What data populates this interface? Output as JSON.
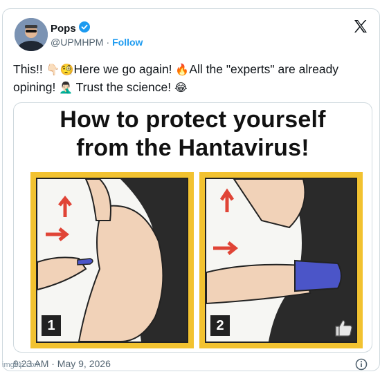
{
  "author": {
    "name": "Pops",
    "handle": "@UPMHPM",
    "follow_label": "Follow",
    "verified": true
  },
  "post": {
    "segment1": "This!! ",
    "emoji1": "👇🏻",
    "emoji2": "🧐",
    "segment2": "Here we go again! ",
    "emoji3": "🔥",
    "segment3": "All the \"experts\" are already opining! ",
    "emoji4": "🤦🏻‍♂️",
    "segment4": " Trust the science! ",
    "emoji5": "😂"
  },
  "media": {
    "title_line1": "How to protect yourself",
    "title_line2": "from the Hantavirus!",
    "panel1_number": "1",
    "panel2_number": "2"
  },
  "timestamp": "9:23 AM · May 9, 2026",
  "watermark": "imgflip.com",
  "icons": [
    "x-logo-icon",
    "verified-badge-icon",
    "info-icon",
    "thumbs-up-icon"
  ],
  "colors": {
    "link": "#1d9bf0",
    "panel_border": "#f2c230",
    "muted": "#536471"
  }
}
